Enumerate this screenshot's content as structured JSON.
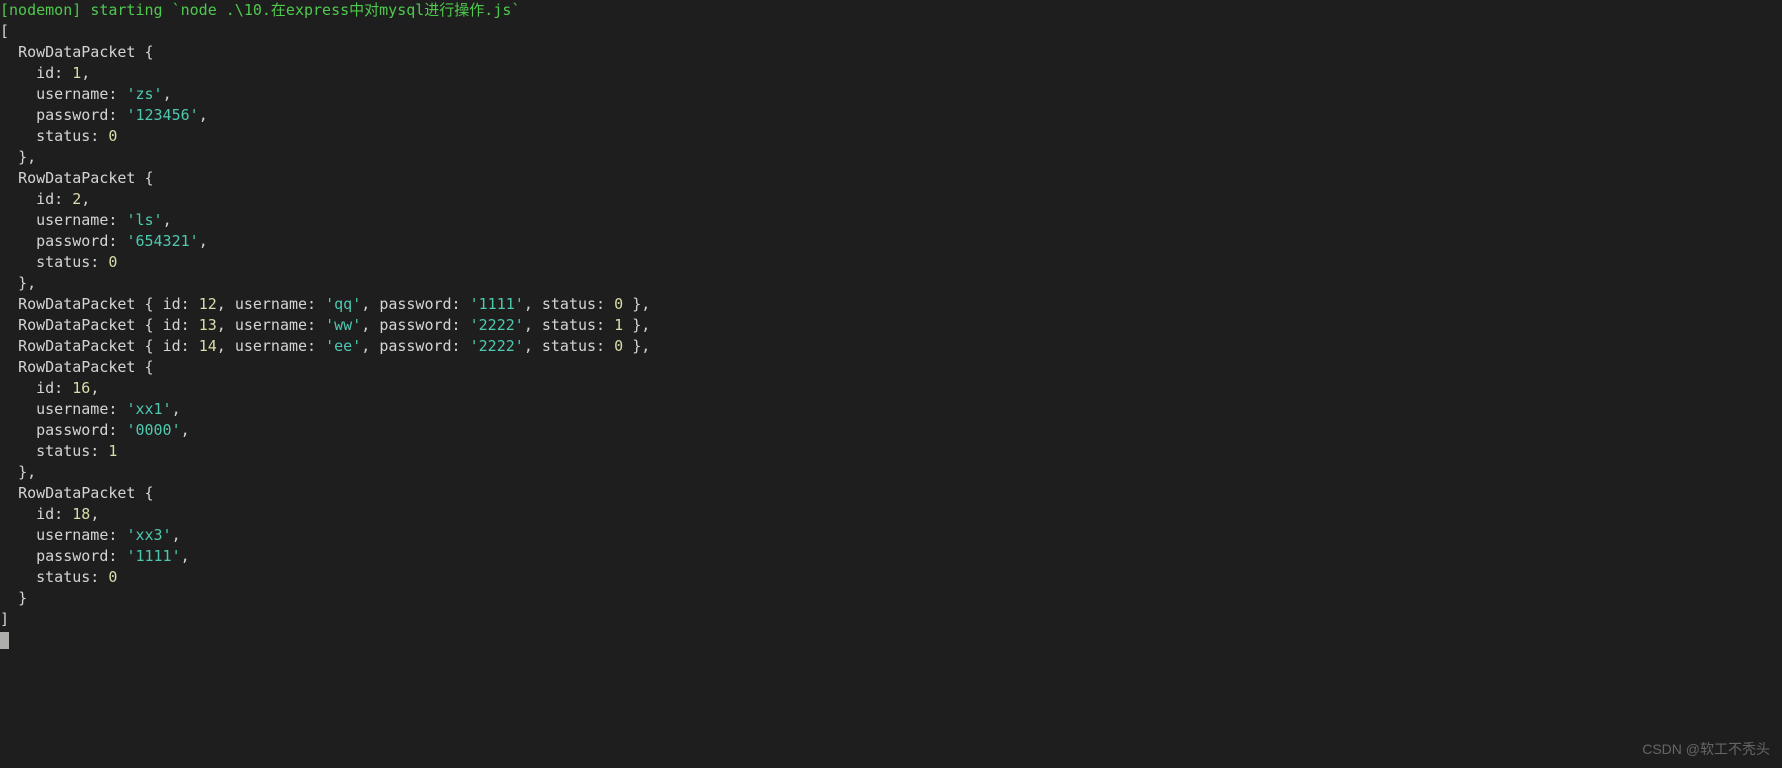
{
  "header": {
    "prefix": "[nodemon]",
    "action": "starting",
    "command": "`node .\\10.在express中对mysql进行操作.js`"
  },
  "rowdata_label": "RowDataPacket",
  "keys": {
    "id": "id",
    "username": "username",
    "password": "password",
    "status": "status"
  },
  "rows": [
    {
      "id": "1",
      "username": "'zs'",
      "password": "'123456'",
      "status": "0",
      "inline": false
    },
    {
      "id": "2",
      "username": "'ls'",
      "password": "'654321'",
      "status": "0",
      "inline": false
    },
    {
      "id": "12",
      "username": "'qq'",
      "password": "'1111'",
      "status": "0",
      "inline": true
    },
    {
      "id": "13",
      "username": "'ww'",
      "password": "'2222'",
      "status": "1",
      "inline": true
    },
    {
      "id": "14",
      "username": "'ee'",
      "password": "'2222'",
      "status": "0",
      "inline": true
    },
    {
      "id": "16",
      "username": "'xx1'",
      "password": "'0000'",
      "status": "1",
      "inline": false
    },
    {
      "id": "18",
      "username": "'xx3'",
      "password": "'1111'",
      "status": "0",
      "inline": false,
      "last": true
    }
  ],
  "watermark": "CSDN @软工不秃头"
}
